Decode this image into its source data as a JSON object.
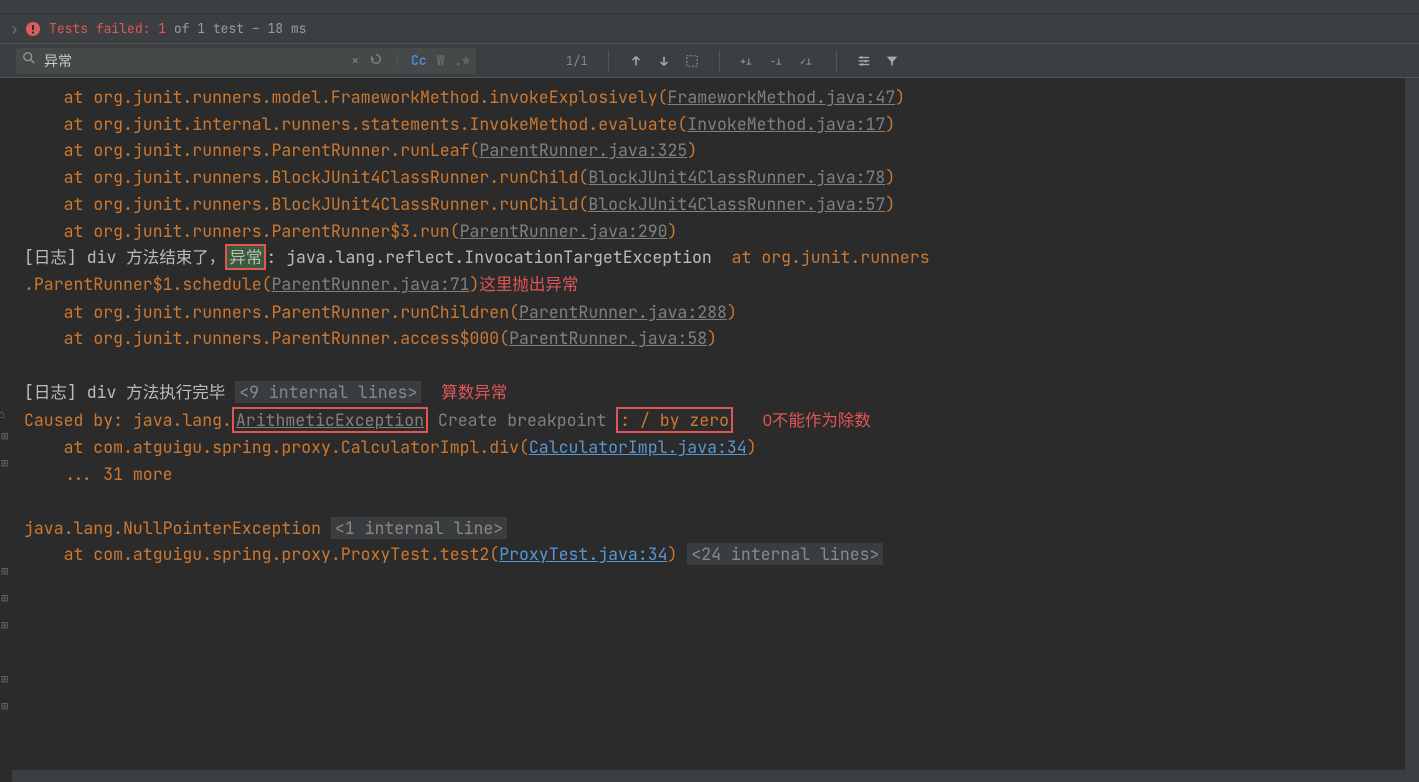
{
  "status": {
    "prefix": "Tests failed:",
    "count": "1",
    "rest": "of 1 test – 18 ms"
  },
  "search": {
    "value": "异常",
    "cc": "Cc",
    "w": "W",
    "regex": ".*"
  },
  "counter": "1/1",
  "lines": {
    "l1a": "    at ",
    "l1b": "org.junit.runners.model.FrameworkMethod.invokeExplosively",
    "l1c": "(",
    "l1d": "FrameworkMethod.java:47",
    "l1e": ")",
    "l2a": "    at ",
    "l2b": "org.junit.internal.runners.statements.InvokeMethod.evaluate",
    "l2c": "(",
    "l2d": "InvokeMethod.java:17",
    "l2e": ")",
    "l3a": "    at ",
    "l3b": "org.junit.runners.ParentRunner.runLeaf",
    "l3c": "(",
    "l3d": "ParentRunner.java:325",
    "l3e": ")",
    "l4a": "    at ",
    "l4b": "org.junit.runners.BlockJUnit4ClassRunner.runChild",
    "l4c": "(",
    "l4d": "BlockJUnit4ClassRunner.java:78",
    "l4e": ")",
    "l5a": "    at ",
    "l5b": "org.junit.runners.BlockJUnit4ClassRunner.runChild",
    "l5c": "(",
    "l5d": "BlockJUnit4ClassRunner.java:57",
    "l5e": ")",
    "l6a": "    at ",
    "l6b": "org.junit.runners.ParentRunner$3.run",
    "l6c": "(",
    "l6d": "ParentRunner.java:290",
    "l6e": ")",
    "l7a": "[日志] div 方法结束了，",
    "l7hl": "异常",
    "l7b": ": java.lang.reflect.InvocationTargetException",
    "l7c": "  at ",
    "l7d": "org.junit.runners",
    "l8a": ".ParentRunner$1.schedule",
    "l8b": "(",
    "l8c": "ParentRunner.java:71",
    "l8d": ")",
    "l8annot": "这里抛出异常",
    "l9a": "    at ",
    "l9b": "org.junit.runners.ParentRunner.runChildren",
    "l9c": "(",
    "l9d": "ParentRunner.java:288",
    "l9e": ")",
    "l10a": "    at ",
    "l10b": "org.junit.runners.ParentRunner.access$000",
    "l10c": "(",
    "l10d": "ParentRunner.java:58",
    "l10e": ")",
    "l11a": "[日志] div 方法执行完毕 ",
    "l11b": "<9 internal lines>",
    "l11annot": "算数异常",
    "l12a": "Caused by: java.lang.",
    "l12b": "ArithmeticException",
    "l12c": "Create breakpoint",
    "l12d": ": / by zero",
    "l12annot": "0不能作为除数",
    "l13a": "    at com.atguigu.spring.proxy.CalculatorImpl.div(",
    "l13b": "CalculatorImpl.java:34",
    "l13c": ")",
    "l14": "    ... 31 more",
    "l15a": "java.lang.NullPointerException ",
    "l15b": "<1 internal line>",
    "l16a": "    at com.atguigu.spring.proxy.ProxyTest.test2(",
    "l16b": "ProxyTest.java:34",
    "l16c": ") ",
    "l16d": "<24 internal lines>"
  }
}
